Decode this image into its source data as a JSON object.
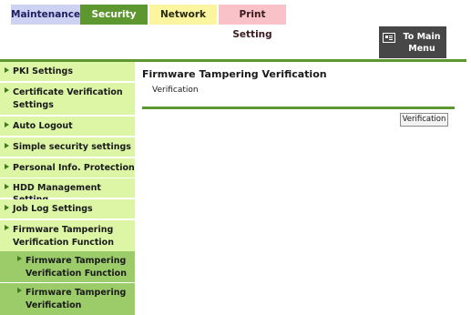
{
  "tabs": [
    {
      "label": "Maintenance"
    },
    {
      "label": "Security"
    },
    {
      "label": "Network"
    },
    {
      "label": "Print Setting"
    }
  ],
  "main_menu": {
    "line1": "To Main",
    "line2": "Menu",
    "icon": "main-menu-icon"
  },
  "sidebar": {
    "items": [
      {
        "label": "PKI Settings"
      },
      {
        "label1": "Certificate Verification",
        "label2": "Settings"
      },
      {
        "label": "Auto Logout"
      },
      {
        "label": "Simple security settings"
      },
      {
        "label": "Personal Info. Protection"
      },
      {
        "label": "HDD Management Setting"
      },
      {
        "label": "Job Log Settings"
      },
      {
        "label1": "Firmware Tampering",
        "label2": "Verification Function"
      },
      {
        "label1": "Firmware Tampering",
        "label2": "Verification Function"
      },
      {
        "label1": "Firmware Tampering",
        "label2": "Verification"
      }
    ]
  },
  "content": {
    "title": "Firmware Tampering Verification",
    "subtitle": "Verification",
    "button": "Verification"
  },
  "colors": {
    "accent_green": "#5e972f",
    "sidebar_bg": "#dcf6a6",
    "sidebar_sub_bg": "#9ccc6a",
    "tab_maintenance": "#cdd1f2",
    "tab_network": "#fbf5a0",
    "tab_print": "#f8c2c8",
    "main_menu_bg": "#474747"
  }
}
